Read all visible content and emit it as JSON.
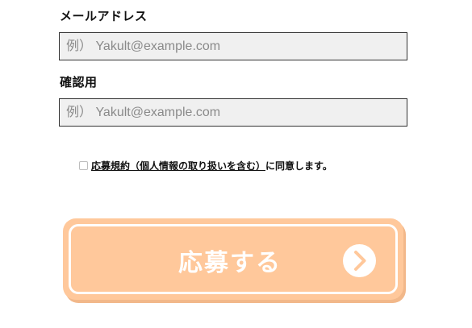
{
  "form": {
    "email": {
      "label": "メールアドレス",
      "placeholder": "例） Yakult@example.com",
      "value": ""
    },
    "confirm": {
      "label": "確認用",
      "placeholder": "例） Yakult@example.com",
      "value": ""
    },
    "consent": {
      "checked": false,
      "link_text": "応募規約（個人情報の取り扱いを含む）",
      "suffix_text": "に同意します。"
    },
    "submit": {
      "label": "応募する",
      "icon": "chevron-right-circle-icon",
      "background_color": "#ffc89b",
      "enabled": false
    }
  }
}
